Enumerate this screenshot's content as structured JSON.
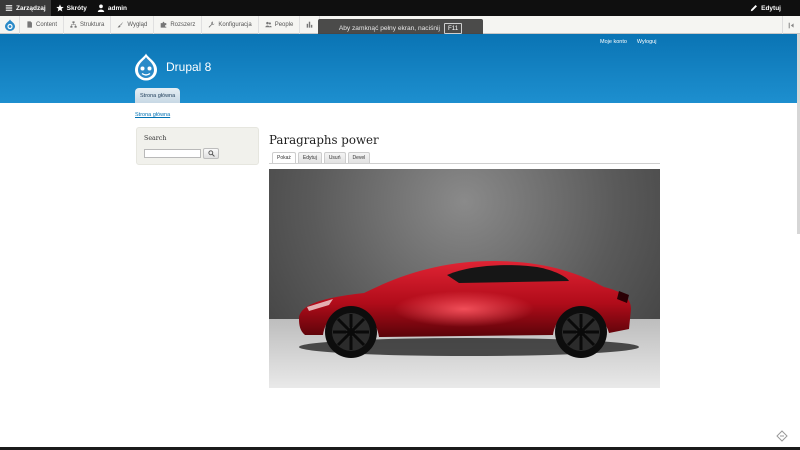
{
  "toolbar": {
    "manage_label": "Zarządzaj",
    "shortcuts_label": "Skróty",
    "user_label": "admin",
    "edit_label": "Edytuj"
  },
  "admin_menu": {
    "items": [
      {
        "label": "Content",
        "icon": "file-icon"
      },
      {
        "label": "Struktura",
        "icon": "sitemap-icon"
      },
      {
        "label": "Wygląd",
        "icon": "brush-icon"
      },
      {
        "label": "Rozszerz",
        "icon": "puzzle-icon"
      },
      {
        "label": "Konfiguracja",
        "icon": "wrench-icon"
      },
      {
        "label": "People",
        "icon": "people-icon"
      },
      {
        "label": "",
        "icon": "bar-chart-icon"
      }
    ]
  },
  "fullscreen_notice": {
    "text": "Aby zamknąć pełny ekran, naciśnij",
    "key": "F11"
  },
  "header": {
    "secondary_menu": [
      "Moje konto",
      "Wyloguj"
    ],
    "site_name": "Drupal 8",
    "primary_tab": "Strona główna"
  },
  "breadcrumb": "Strona główna",
  "sidebar": {
    "search_title": "Search"
  },
  "content": {
    "title": "Paragraphs power",
    "tabs": [
      "Pokaż",
      "Edytuj",
      "Usuń",
      "Devel"
    ]
  },
  "colors": {
    "header_blue": "#0a74b4",
    "toolbar_black": "#0f0f0f",
    "car_red": "#c0101c"
  }
}
